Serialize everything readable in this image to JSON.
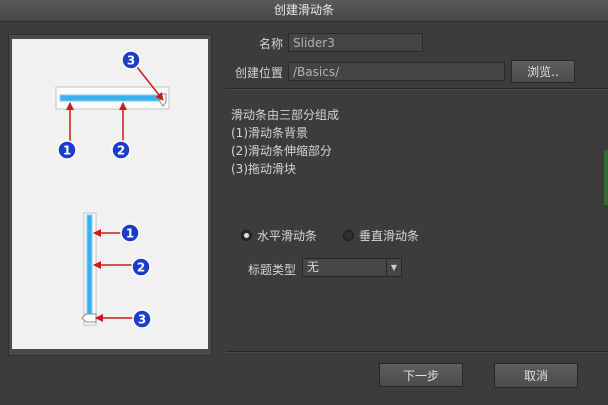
{
  "window": {
    "title": "创建滑动条"
  },
  "form": {
    "name_label": "名称",
    "name_value": "Slider3",
    "location_label": "创建位置",
    "location_value": "/Basics/",
    "browse_label": "浏览.."
  },
  "description": [
    "滑动条由三部分组成",
    "(1)滑动条背景",
    "(2)滑动条伸缩部分",
    "(3)拖动滑块"
  ],
  "orientation": {
    "horizontal_label": "水平滑动条",
    "vertical_label": "垂直滑动条",
    "selected": "horizontal"
  },
  "title_type": {
    "label": "标题类型",
    "value": "无"
  },
  "preview": {
    "markers": [
      "1",
      "2",
      "3"
    ],
    "accent_color": "#3ab0ec",
    "marker_color": "#1a3ec8",
    "arrow_color": "#cc1b1b"
  },
  "footer": {
    "next_label": "下一步",
    "cancel_label": "取消"
  }
}
